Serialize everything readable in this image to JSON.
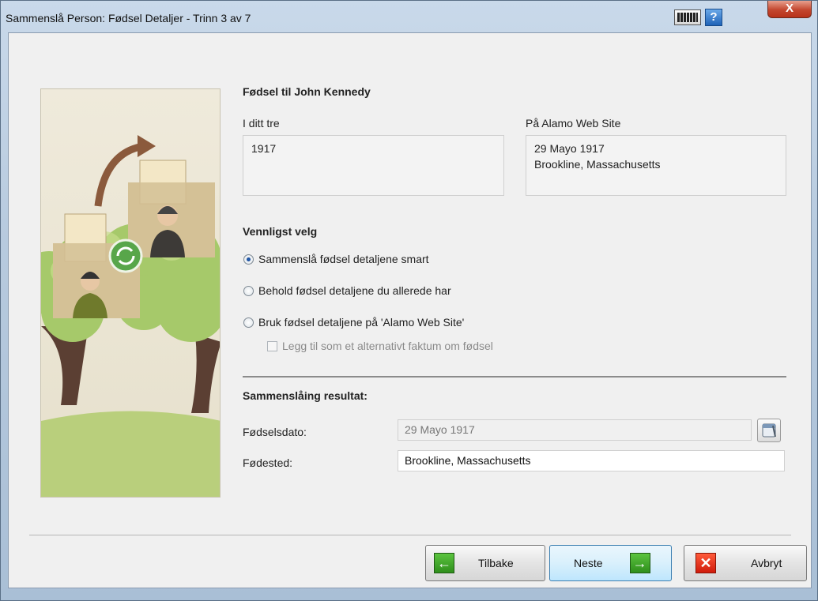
{
  "window": {
    "title": "Sammenslå Person: Fødsel Detaljer - Trinn 3 av 7",
    "help_label": "?",
    "close_label": "X"
  },
  "header": {
    "title": "Fødsel til John Kennedy"
  },
  "compare": {
    "left_label": "I ditt tre",
    "left_lines": [
      "1917",
      ""
    ],
    "right_label": "På Alamo Web Site",
    "right_lines": [
      "29 Mayo 1917",
      "Brookline, Massachusetts"
    ]
  },
  "choice": {
    "heading": "Vennligst velg",
    "options": [
      {
        "label": "Sammenslå fødsel detaljene smart",
        "selected": true
      },
      {
        "label": "Behold fødsel detaljene du allerede har",
        "selected": false
      },
      {
        "label": "Bruk fødsel detaljene på 'Alamo Web Site'",
        "selected": false
      }
    ],
    "alt_fact_label": "Legg til som et alternativt faktum om fødsel"
  },
  "result": {
    "heading": "Sammenslåing resultat:",
    "date_label": "Fødselsdato:",
    "date_value": "29 Mayo 1917",
    "place_label": "Fødested:",
    "place_value": "Brookline, Massachusetts"
  },
  "buttons": {
    "back": "Tilbake",
    "next": "Neste",
    "cancel": "Avbryt"
  },
  "icons": [
    "keyboard-icon",
    "help-icon",
    "close-icon",
    "calendar-icon",
    "arrow-left-icon",
    "arrow-right-icon",
    "cancel-x-icon",
    "sync-icon"
  ]
}
